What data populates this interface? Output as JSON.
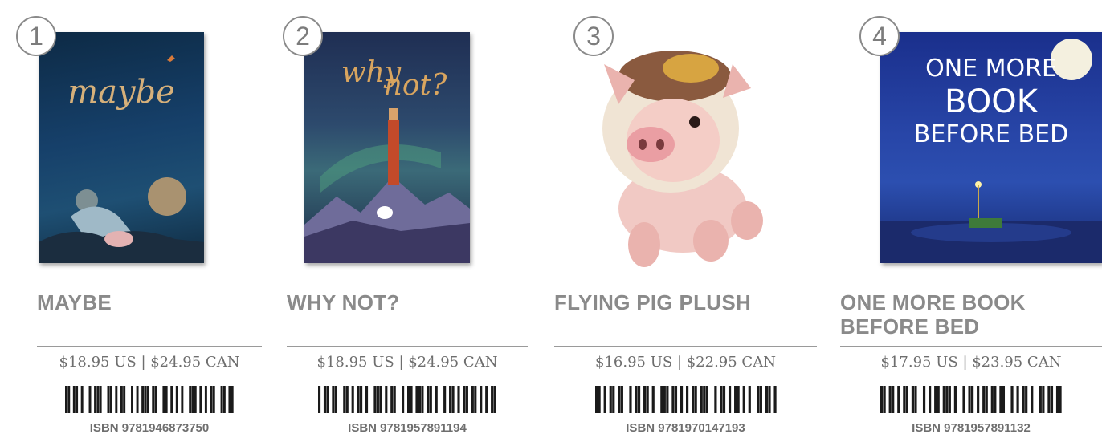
{
  "products": [
    {
      "number": "1",
      "cover_title": "maybe",
      "title_lines": [
        "MAYBE",
        ""
      ],
      "price": "$18.95 US | $24.95 CAN",
      "isbn": "ISBN 9781946873750",
      "bars": "1101101001011100110101100101011101100110101010011101010110011011"
    },
    {
      "number": "2",
      "cover_title_1": "why",
      "cover_title_2": "not?",
      "title_lines": [
        "WHY NOT?",
        ""
      ],
      "price": "$18.95 US | $24.95 CAN",
      "isbn": "ISBN 9781957891194",
      "bars": "1011011001101011010011101011001011011101101001011010110110101011"
    },
    {
      "number": "3",
      "title_lines": [
        "FLYING PIG PLUSH",
        ""
      ],
      "price": "$16.95 US | $22.95 CAN",
      "isbn": "ISBN 9781970147193",
      "bars": "1101011011001011011010011101101010110111001011010110101001101101"
    },
    {
      "number": "4",
      "cover_title_1": "ONE MORE",
      "cover_title_2": "BOOK",
      "cover_title_3": "BEFORE BED",
      "title_lines": [
        "ONE MORE BOOK",
        "BEFORE BED"
      ],
      "price": "$17.95 US | $23.95 CAN",
      "isbn": "ISBN 9781957891132",
      "bars": "1101101011011001010110111010010110101101101100101011010011011011"
    }
  ]
}
